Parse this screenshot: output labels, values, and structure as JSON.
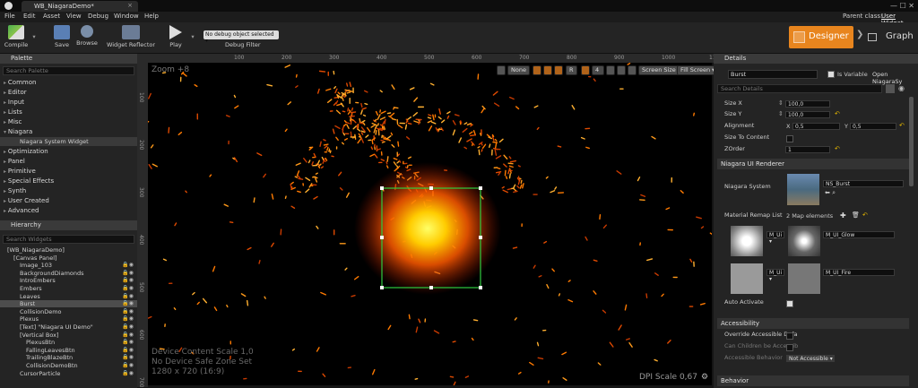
{
  "window": {
    "tab_title": "WB_NiagaraDemo*",
    "tab_close": "×",
    "parent_class_label": "Parent class:",
    "parent_class_value": "User Widget",
    "dot": "•"
  },
  "menu": [
    "File",
    "Edit",
    "Asset",
    "View",
    "Debug",
    "Window",
    "Help"
  ],
  "toolbar": {
    "compile": "Compile",
    "save": "Save",
    "browse": "Browse",
    "widget_reflector": "Widget Reflector",
    "play": "Play",
    "debug_object": "No debug object selected ▾",
    "debug_filter": "Debug Filter",
    "designer": "Designer",
    "graph": "Graph"
  },
  "palette": {
    "title": "Palette",
    "search_placeholder": "Search Palette",
    "categories": [
      "Common",
      "Editor",
      "Input",
      "Lists",
      "Misc",
      "Niagara",
      "Optimization",
      "Panel",
      "Primitive",
      "Special Effects",
      "Synth",
      "User Created",
      "Advanced"
    ],
    "niagara_item": "Niagara System Widget"
  },
  "hierarchy": {
    "title": "Hierarchy",
    "search_placeholder": "Search Widgets",
    "items": [
      {
        "label": "[WB_NiagaraDemo]",
        "indent": 0
      },
      {
        "label": "[Canvas Panel]",
        "indent": 1
      },
      {
        "label": "Image_103",
        "indent": 2
      },
      {
        "label": "BackgroundDiamonds",
        "indent": 2
      },
      {
        "label": "IntroEmbers",
        "indent": 2
      },
      {
        "label": "Embers",
        "indent": 2
      },
      {
        "label": "Leaves",
        "indent": 2
      },
      {
        "label": "Burst",
        "indent": 2,
        "selected": true
      },
      {
        "label": "CollisionDemo",
        "indent": 2
      },
      {
        "label": "Plexus",
        "indent": 2
      },
      {
        "label": "[Text] \"Niagara UI Demo\"",
        "indent": 2
      },
      {
        "label": "[Vertical Box]",
        "indent": 2
      },
      {
        "label": "PlexusBtn",
        "indent": 3
      },
      {
        "label": "FallingLeavesBtn",
        "indent": 3
      },
      {
        "label": "TrailingBlazeBtn",
        "indent": 3
      },
      {
        "label": "CollisionDemoBtn",
        "indent": 3
      },
      {
        "label": "CursorParticle",
        "indent": 2
      }
    ]
  },
  "viewport": {
    "zoom": "Zoom +8",
    "none_btn": "None",
    "r_btn": "R",
    "num_btn": "4",
    "screen_size": "Screen Size ▾",
    "fill_screen": "Fill Screen ▾",
    "info_lines": [
      "Device Content Scale 1,0",
      "No Device Safe Zone Set",
      "1280 x 720 (16:9)"
    ],
    "dpi": "DPI Scale 0,67",
    "ruler_top": [
      "100",
      "200",
      "300",
      "400",
      "500",
      "600",
      "700",
      "800",
      "900",
      "1000",
      "1100",
      "1200"
    ],
    "ruler_left": [
      "100",
      "200",
      "300",
      "400",
      "500",
      "600",
      "700"
    ]
  },
  "details": {
    "title": "Details",
    "name": "Burst",
    "is_variable": "Is Variable",
    "open_link": "Open NiagaraSy",
    "search_placeholder": "Search Details",
    "rows": [
      {
        "label": "Size X",
        "value": "100,0"
      },
      {
        "label": "Size Y",
        "value": "100,0"
      }
    ],
    "alignment_label": "Alignment",
    "align_x_label": "X",
    "align_x": "0,5",
    "align_y_label": "Y",
    "align_y": "0,5",
    "size_to_content": "Size To Content",
    "zorder_label": "ZOrder",
    "zorder": "1",
    "niagara_section": "Niagara UI Renderer",
    "niagara_system_label": "Niagara System",
    "niagara_asset": "NS_Burst",
    "material_remap_label": "Material Remap List",
    "map_count": "2 Map elements",
    "remap": [
      {
        "from": "M_Ui ▾",
        "to": "M_UI_Glow"
      },
      {
        "from": "M_Ui ▾",
        "to": "M_UI_Fire"
      }
    ],
    "auto_activate": "Auto Activate",
    "accessibility_section": "Accessibility",
    "override_access": "Override Accessible Defa",
    "can_children": "Can Children be Accessib",
    "access_behavior_label": "Accessible Behavior",
    "access_behavior_value": "Not Accessible ▾",
    "behavior_section": "Behavior"
  },
  "colors": {
    "accent": "#e8851e",
    "selection": "#3fae3f",
    "background": "#242424"
  }
}
